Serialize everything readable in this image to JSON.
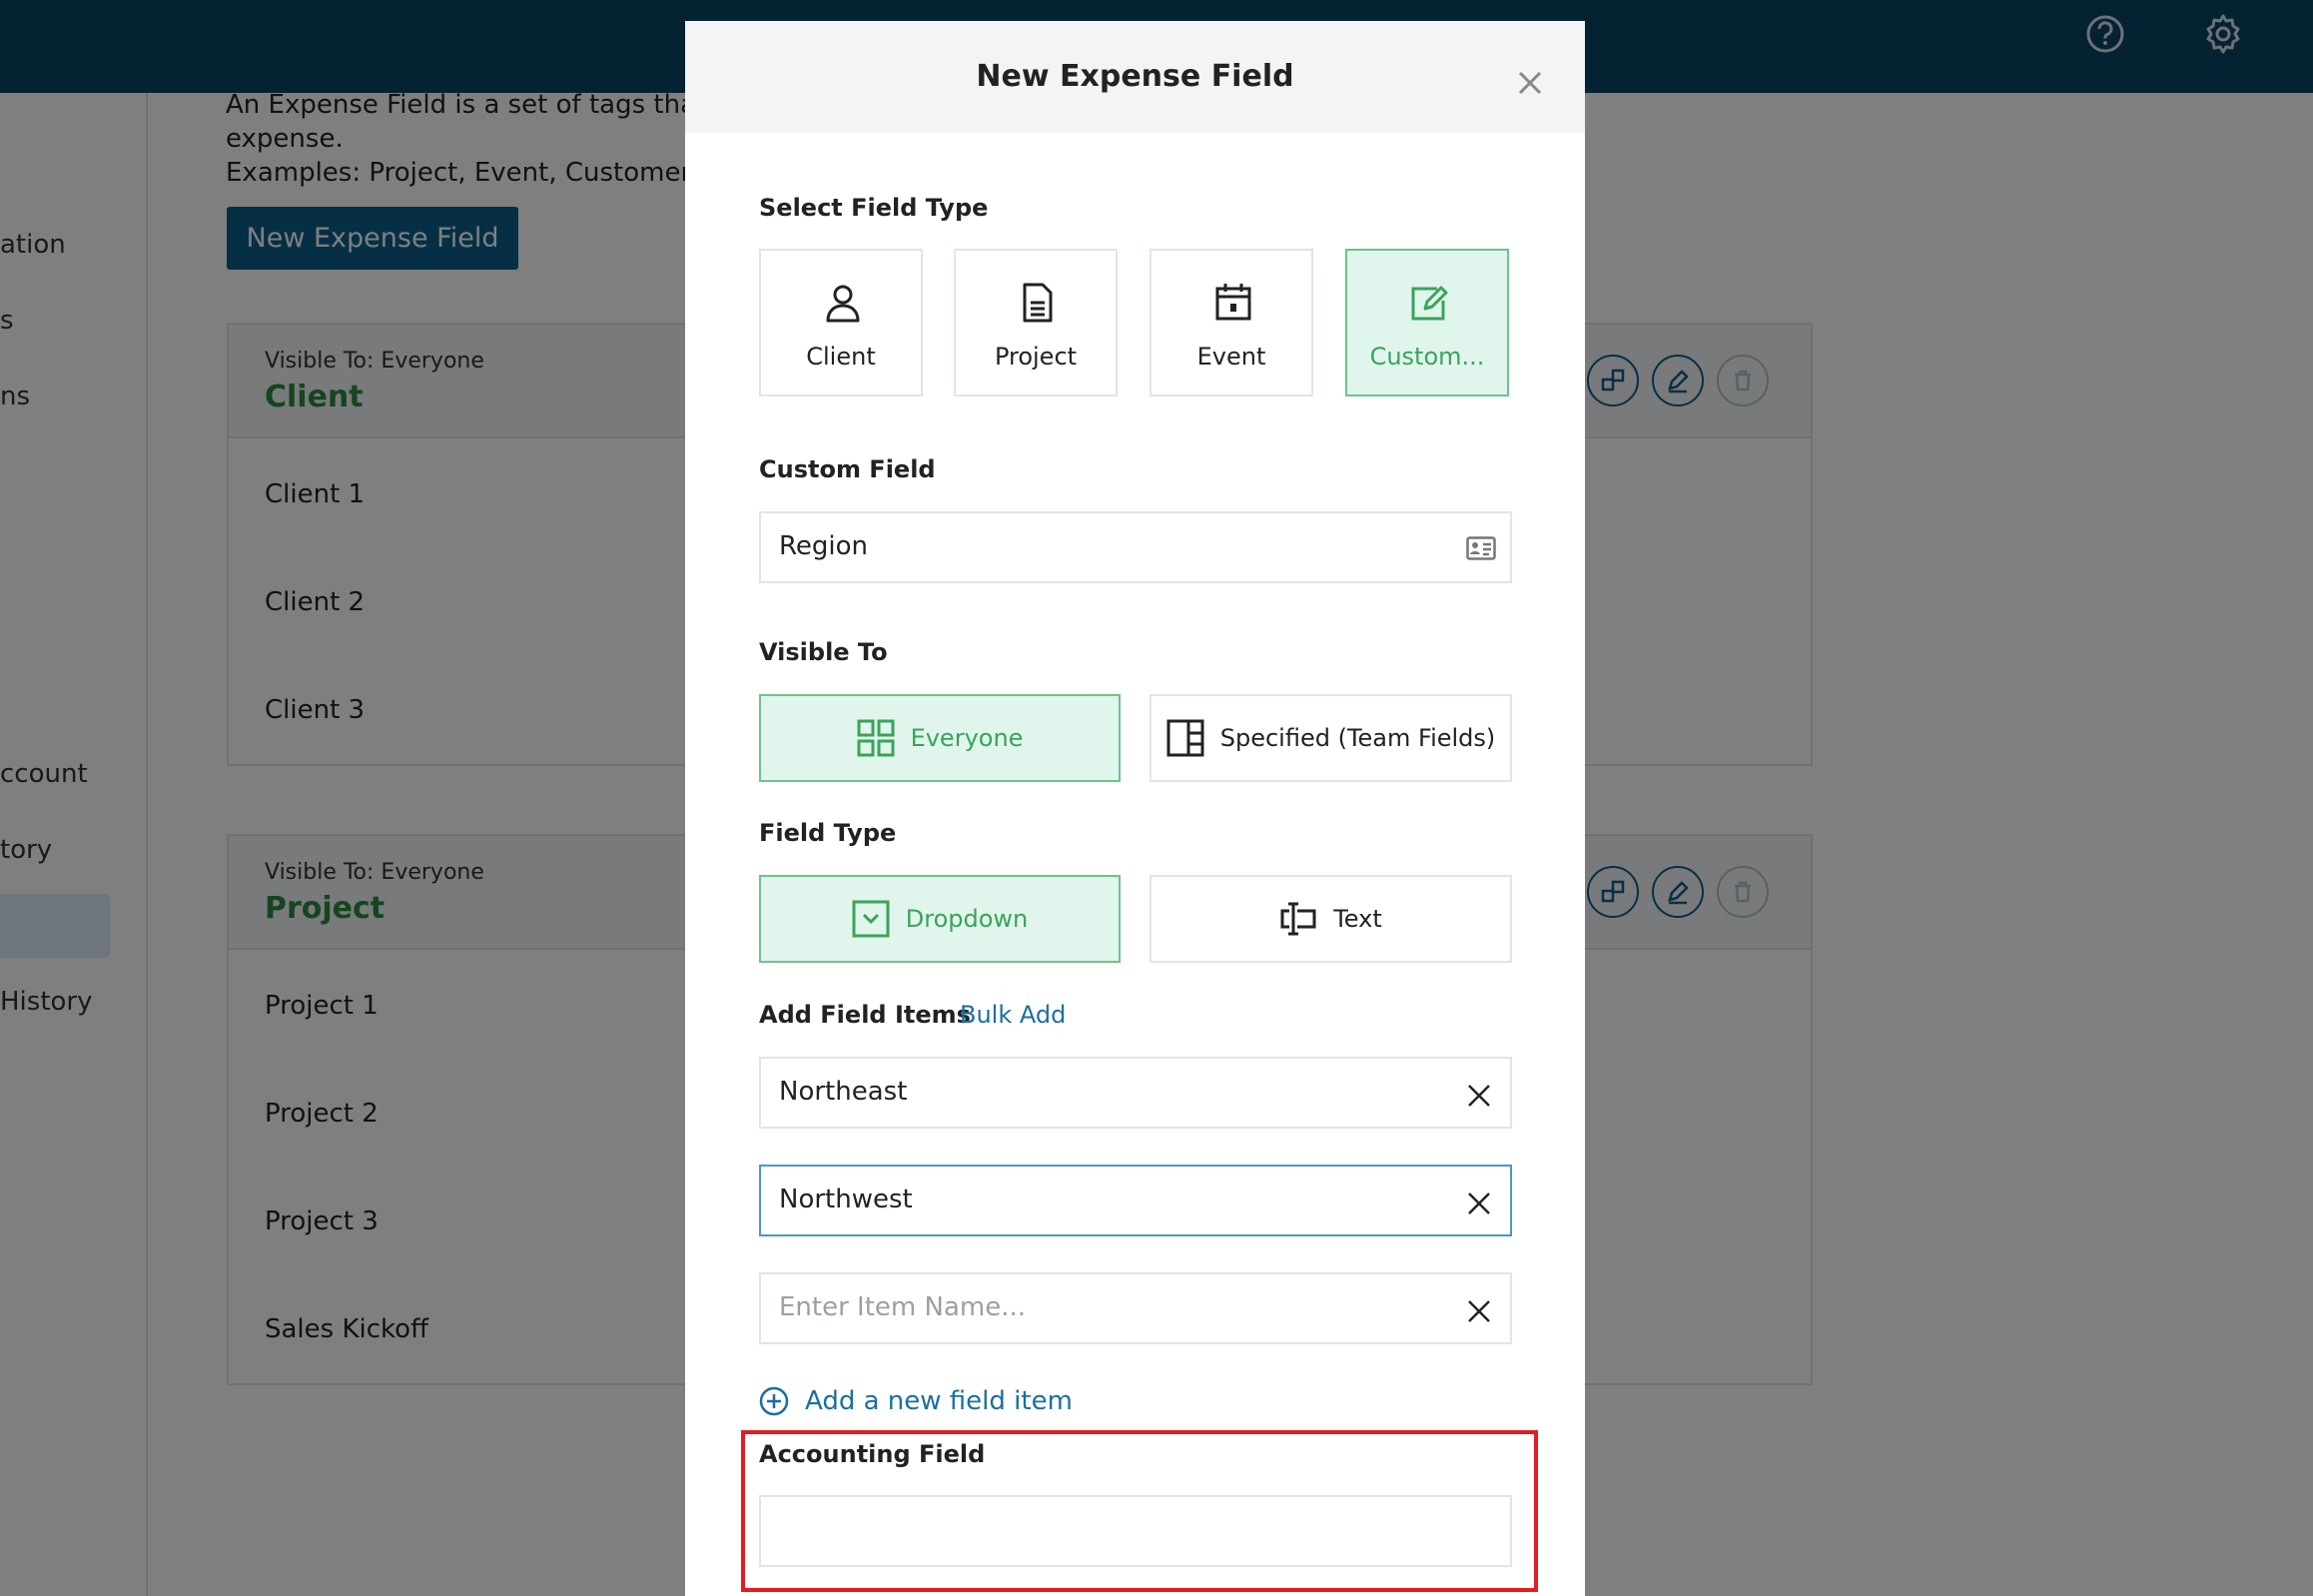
{
  "topbar": {
    "help_icon": "question-circle-icon",
    "settings_icon": "gear-icon"
  },
  "sidebar": {
    "items": [
      {
        "label": "ation"
      },
      {
        "label": "s"
      },
      {
        "label": "ns"
      },
      {
        "label": "ccount"
      },
      {
        "label": "tory"
      },
      {
        "label": ""
      },
      {
        "label": "History"
      }
    ]
  },
  "background": {
    "description_line1": "An Expense Field is a set of tags that yo",
    "description_line2": "expense.",
    "description_line3": "Examples: Project, Event, Customer.",
    "new_button": "New Expense Field",
    "panels": [
      {
        "visible_to": "Visible To: Everyone",
        "title": "Client",
        "rows": [
          "Client 1",
          "Client 2",
          "Client 3"
        ]
      },
      {
        "visible_to": "Visible To: Everyone",
        "title": "Project",
        "rows": [
          "Project 1",
          "Project 2",
          "Project 3",
          "Sales Kickoff"
        ]
      }
    ]
  },
  "modal": {
    "title": "New Expense Field",
    "select_field_type_label": "Select Field Type",
    "field_types": [
      {
        "label": "Client",
        "icon": "person-icon",
        "selected": false
      },
      {
        "label": "Project",
        "icon": "document-icon",
        "selected": false
      },
      {
        "label": "Event",
        "icon": "calendar-icon",
        "selected": false
      },
      {
        "label": "Custom...",
        "icon": "edit-icon",
        "selected": true
      }
    ],
    "custom_field_label": "Custom Field",
    "custom_field_value": "Region",
    "visible_to_label": "Visible To",
    "visible_to_options": [
      {
        "label": "Everyone",
        "icon": "grid-icon",
        "selected": true
      },
      {
        "label": "Specified (Team Fields)",
        "icon": "layout-icon",
        "selected": false
      }
    ],
    "field_type_label": "Field Type",
    "field_type_options": [
      {
        "label": "Dropdown",
        "icon": "dropdown-icon",
        "selected": true
      },
      {
        "label": "Text",
        "icon": "text-cursor-icon",
        "selected": false
      }
    ],
    "add_field_items_label": "Add Field Items",
    "bulk_add_label": "Bulk Add",
    "items": [
      {
        "value": "Northeast",
        "placeholder": ""
      },
      {
        "value": "Northwest",
        "placeholder": ""
      },
      {
        "value": "",
        "placeholder": "Enter Item Name..."
      }
    ],
    "add_item_label": "Add a new field item",
    "accounting_field_label": "Accounting Field",
    "accounting_field_value": ""
  },
  "colors": {
    "topbar": "#0a4566",
    "accent_green": "#3aa35a",
    "link_blue": "#1a6f9f",
    "highlight_red": "#e41b23"
  }
}
